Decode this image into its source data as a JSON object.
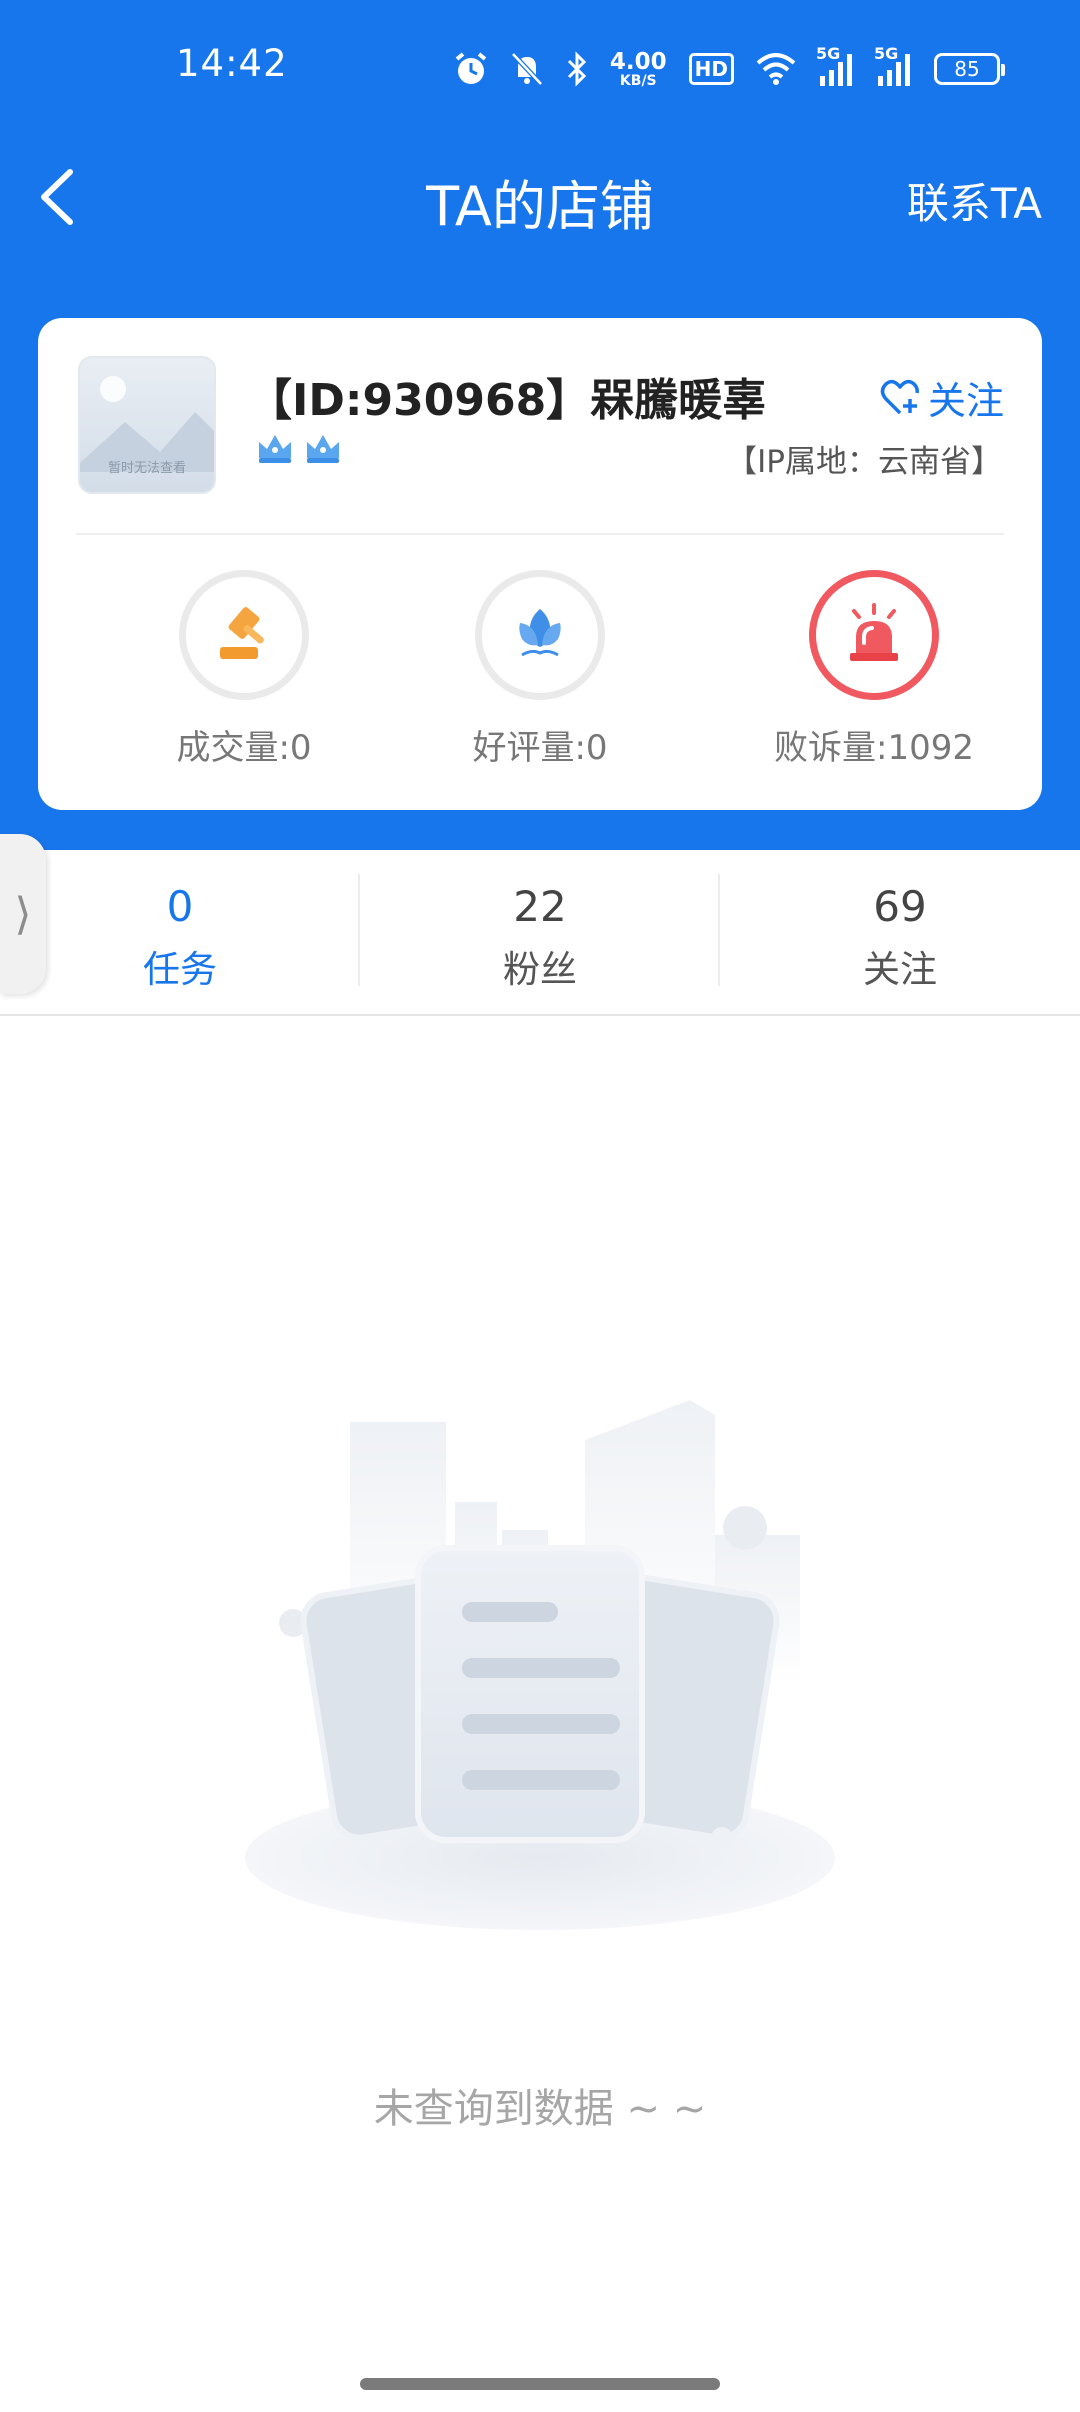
{
  "status_bar": {
    "time": "14:42",
    "net_speed": "4.00",
    "net_unit": "KB/S",
    "hd": "HD",
    "sig1": "5G",
    "sig2": "5G",
    "battery": "85",
    "icons": [
      "alarm-icon",
      "mute-icon",
      "bluetooth-icon",
      "wifi-icon",
      "signal-icon",
      "battery-icon"
    ]
  },
  "nav": {
    "title": "TA的店铺",
    "contact": "联系TA",
    "back_icon": "chevron-left-icon"
  },
  "shop": {
    "avatar_text": "暂时无法查看",
    "name": "【ID:930968】槑騰暖辜",
    "follow_label": "关注",
    "ip": "【IP属地：云南省】",
    "crown_count": 2,
    "stats": [
      {
        "label": "成交量:0",
        "icon": "gavel-icon"
      },
      {
        "label": "好评量:0",
        "icon": "lotus-icon"
      },
      {
        "label": "败诉量:1092",
        "icon": "alarm-light-icon"
      }
    ]
  },
  "tabs": [
    {
      "count": "0",
      "label": "任务",
      "active": true
    },
    {
      "count": "22",
      "label": "粉丝",
      "active": false
    },
    {
      "count": "69",
      "label": "关注",
      "active": false
    }
  ],
  "side_handle": "⟩",
  "empty": {
    "text": "未查询到数据 ~ ~"
  },
  "colors": {
    "primary": "#1876ec",
    "alert_red": "#f0595f",
    "gavel_orange": "#f5a540"
  }
}
